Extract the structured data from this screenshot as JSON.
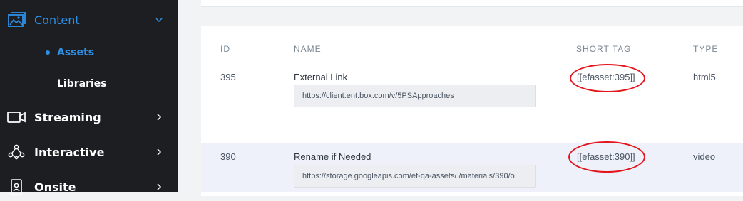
{
  "sidebar": {
    "items": [
      {
        "label": "Content",
        "icon": "image-gallery-icon",
        "expanded": true,
        "active": true
      },
      {
        "label": "Streaming",
        "icon": "video-camera-icon"
      },
      {
        "label": "Interactive",
        "icon": "network-icon"
      },
      {
        "label": "Onsite",
        "icon": "badge-icon"
      }
    ],
    "subitems": [
      {
        "label": "Assets",
        "active": true
      },
      {
        "label": "Libraries"
      }
    ]
  },
  "table": {
    "columns": [
      "ID",
      "NAME",
      "SHORT TAG",
      "TYPE"
    ],
    "rows": [
      {
        "id": "395",
        "name": "External Link",
        "url": "https://client.ent.box.com/v/5PSApproaches",
        "short_tag": "[[efasset:395]]",
        "type": "html5"
      },
      {
        "id": "390",
        "name": "Rename if Needed",
        "url": "https://storage.googleapis.com/ef-qa-assets/./materials/390/o",
        "short_tag": "[[efasset:390]]",
        "type": "video"
      }
    ]
  },
  "colors": {
    "sidebar_bg": "#1d1e22",
    "accent": "#2e8fe6",
    "highlight_ring": "#e3161d",
    "selected_row": "#eef1f9"
  }
}
